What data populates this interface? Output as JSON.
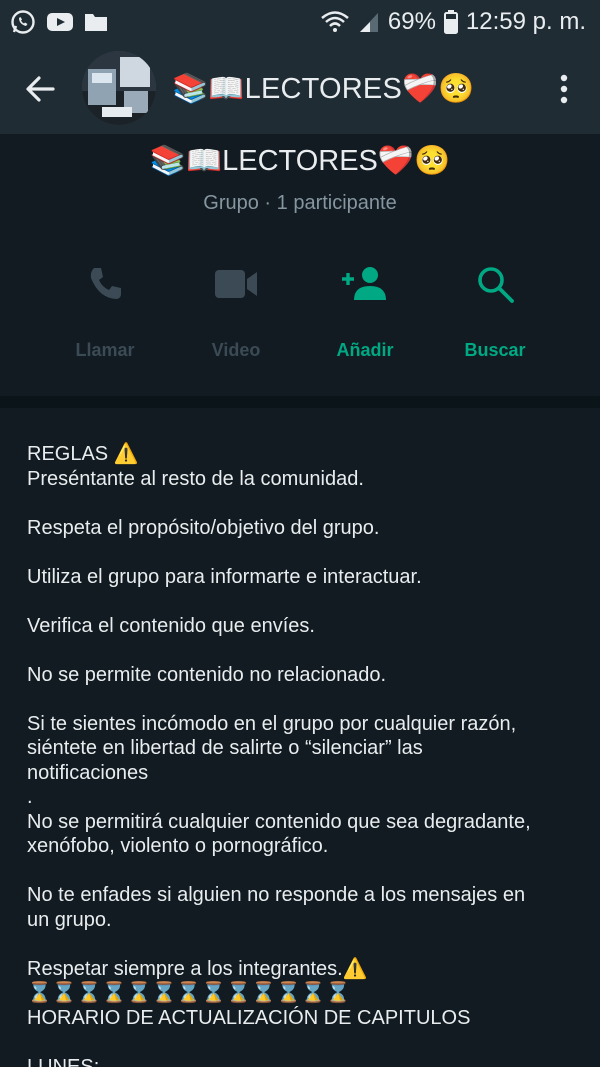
{
  "status_bar": {
    "battery": "69%",
    "time": "12:59 p. m."
  },
  "app_bar": {
    "title": "📚📖LECTORES❤️‍🩹🥺"
  },
  "group": {
    "name": "📚📖LECTORES❤️‍🩹🥺",
    "subtitle": "Grupo · 1 participante"
  },
  "actions": [
    {
      "label": "Llamar",
      "icon": "phone-icon",
      "color": "#3b4a54"
    },
    {
      "label": "Video",
      "icon": "video-icon",
      "color": "#3b4a54"
    },
    {
      "label": "Añadir",
      "icon": "add-person-icon",
      "color": "#00a884"
    },
    {
      "label": "Buscar",
      "icon": "search-icon",
      "color": "#00a884"
    }
  ],
  "description": {
    "lines": [
      "REGLAS ⚠️",
      "Preséntante al resto de la comunidad.",
      "",
      "Respeta el propósito/objetivo del grupo.",
      "",
      "Utiliza el grupo para informarte e interactuar.",
      "",
      "Verifica el contenido que envíes.",
      "",
      "No se permite contenido no relacionado.",
      "",
      "Si te sientes incómodo en el grupo por cualquier razón,",
      "siéntete en libertad de salirte o “silenciar” las",
      "notificaciones",
      ".",
      "No se permitirá cualquier contenido que sea degradante,",
      "xenófobo, violento o pornográfico.",
      "",
      "No te enfades si alguien no responde a los mensajes en",
      "un grupo.",
      "",
      "Respetar siempre a los integrantes.⚠️",
      "⌛⌛⌛⌛⌛⌛⌛⌛⌛⌛⌛⌛⌛",
      "HORARIO DE ACTUALIZACIÓN DE CAPITULOS",
      "",
      "LUNES:"
    ]
  },
  "colors": {
    "background": "#111b21",
    "header": "#1f2c34",
    "accent": "#00a884",
    "muted": "#8696a0"
  }
}
